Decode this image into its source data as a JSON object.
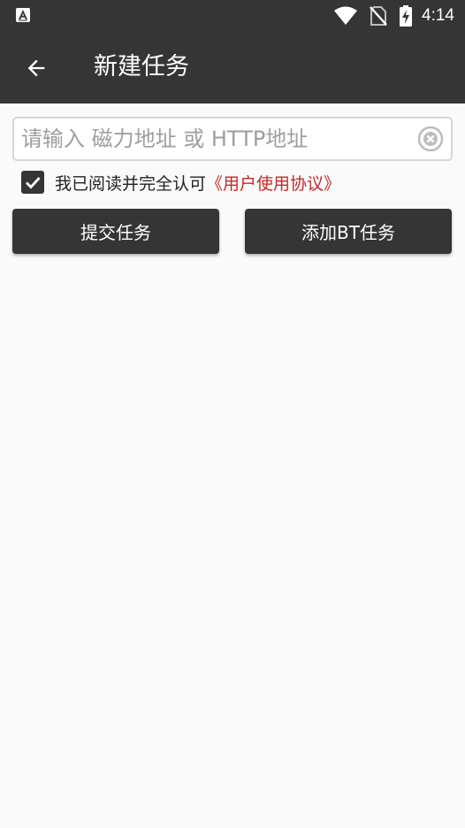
{
  "status_bar": {
    "time": "4:14",
    "icons": [
      "app-notification-icon",
      "wifi-icon",
      "no-sim-icon",
      "battery-charging-icon"
    ]
  },
  "app_bar": {
    "title": "新建任务",
    "back_icon": "back-arrow-icon"
  },
  "url_field": {
    "value": "",
    "placeholder": "请输入 磁力地址 或 HTTP地址",
    "clear_icon": "clear-circle-icon"
  },
  "agreement": {
    "checked": true,
    "text": "我已阅读并完全认可",
    "link_text": "《用户使用协议》",
    "link_color": "#c62828"
  },
  "buttons": {
    "submit_label": "提交任务",
    "add_bt_label": "添加BT任务"
  },
  "colors": {
    "primary": "#353535",
    "background": "#fafafa"
  }
}
